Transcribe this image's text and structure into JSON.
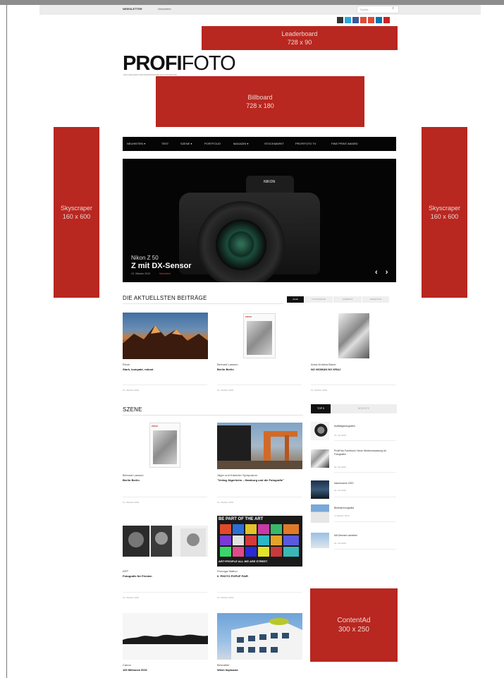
{
  "topbar": {
    "newsletter": "NEWSLETTER",
    "newsletter2": "Newsletter",
    "search_placeholder": "Suche..."
  },
  "social_colors": [
    "#333333",
    "#2aa9e0",
    "#3b5998",
    "#e24a35",
    "#dd4b39",
    "#0077b5",
    "#cc2222"
  ],
  "ads": {
    "leaderboard": {
      "line1": "Leaderboard",
      "line2": "728 x 90"
    },
    "billboard": {
      "line1": "Billboard",
      "line2": "728 x 180"
    },
    "skyscraper_left": {
      "line1": "Skyscraper",
      "line2": "160 x 600"
    },
    "skyscraper_right": {
      "line1": "Skyscraper",
      "line2": "160 x 600"
    },
    "contentad": {
      "line1": "ContentAd",
      "line2": "300 x 250"
    }
  },
  "logo": {
    "bold": "PROFI",
    "thin": "FOTO",
    "sub": "DAS MAGAZIN FÜR PROFESSIONELLE FOTOGRAFIE"
  },
  "nav": {
    "items": [
      "NEUHEITEN ▾",
      "TEST",
      "SZENE ▾",
      "PORTFOLIO",
      "MAGAZIN ▾",
      "STOCKMARKT",
      "PROFIFOTO TV",
      "FINE PRINT AWARD"
    ]
  },
  "slider": {
    "brand": "NIKON",
    "kicker": "Nikon Z 50",
    "title": "Z mit DX-Sensor",
    "date": "10. Oktober 2019",
    "category": "Neuheiten",
    "arrows": "‹ ›"
  },
  "latest": {
    "title": "DIE AKTUELLSTEN BEITRÄGE",
    "tabs": [
      "ALLE",
      "FOTOGRAFIE",
      "KAMERAS",
      "OBJEKTIVE"
    ],
    "cards": [
      {
        "kicker": "Ricoh",
        "title": "Stark, kompakt, robust",
        "date": "10. Oktober 2019"
      },
      {
        "kicker": "Bernard Larsson",
        "title": "Berlin Berlin",
        "date": "10. Oktober 2019"
      },
      {
        "kicker": "Anna-Kristina Bauer",
        "title": "NO WOMAN NO KRAJ",
        "date": "10. Oktober 2019"
      }
    ]
  },
  "szene": {
    "title": "SZENE",
    "cards": [
      {
        "kicker": "Bernard Larsson",
        "title": "Berlin Berlin",
        "date": "10. Oktober 2019"
      },
      {
        "kicker": "Jäger und Kämmler Symposium",
        "title": "\"Verlag Jägerheim – Hamburg und die Fotografie\"",
        "date": "10. Oktober 2019"
      },
      {
        "kicker": "DFP",
        "title": "Fotografie für Frieden",
        "date": "10. Oktober 2019"
      },
      {
        "kicker": "Prounga Station",
        "title": "6. PHOTO POPUP FAIR",
        "date": "10. Oktober 2019"
      },
      {
        "kicker": "Canon",
        "title": "100 Millionen EOS",
        "date": ""
      },
      {
        "kicker": "Benrather",
        "title": "Wiem Impluand",
        "date": ""
      }
    ],
    "poster_text_top": "BE PART OF THE ART",
    "poster_text_bottom": "ART+PEOPLE ALL WE ARE STREET"
  },
  "sidebar": {
    "tabs": [
      "TOP 5",
      "NEUESTE"
    ],
    "items": [
      {
        "title": "Auffälligsfotografen",
        "date": "16. Juli 2019"
      },
      {
        "title": "ProfiFoto Fachbuch: Neue Werbeumsatzung für Fotografen",
        "date": "18. Juli 2019"
      },
      {
        "title": "Nachmanns 2020",
        "date": "22. Juli 2019"
      },
      {
        "title": "Bildmischungsbild",
        "date": "4. Oktober 2019"
      },
      {
        "title": "Mit Zimmern arbeiten",
        "date": "22. Juli 2019"
      }
    ]
  },
  "colors": {
    "ad_red": "#b82720",
    "nav_black": "#050505",
    "accent_red": "#e2483d"
  }
}
